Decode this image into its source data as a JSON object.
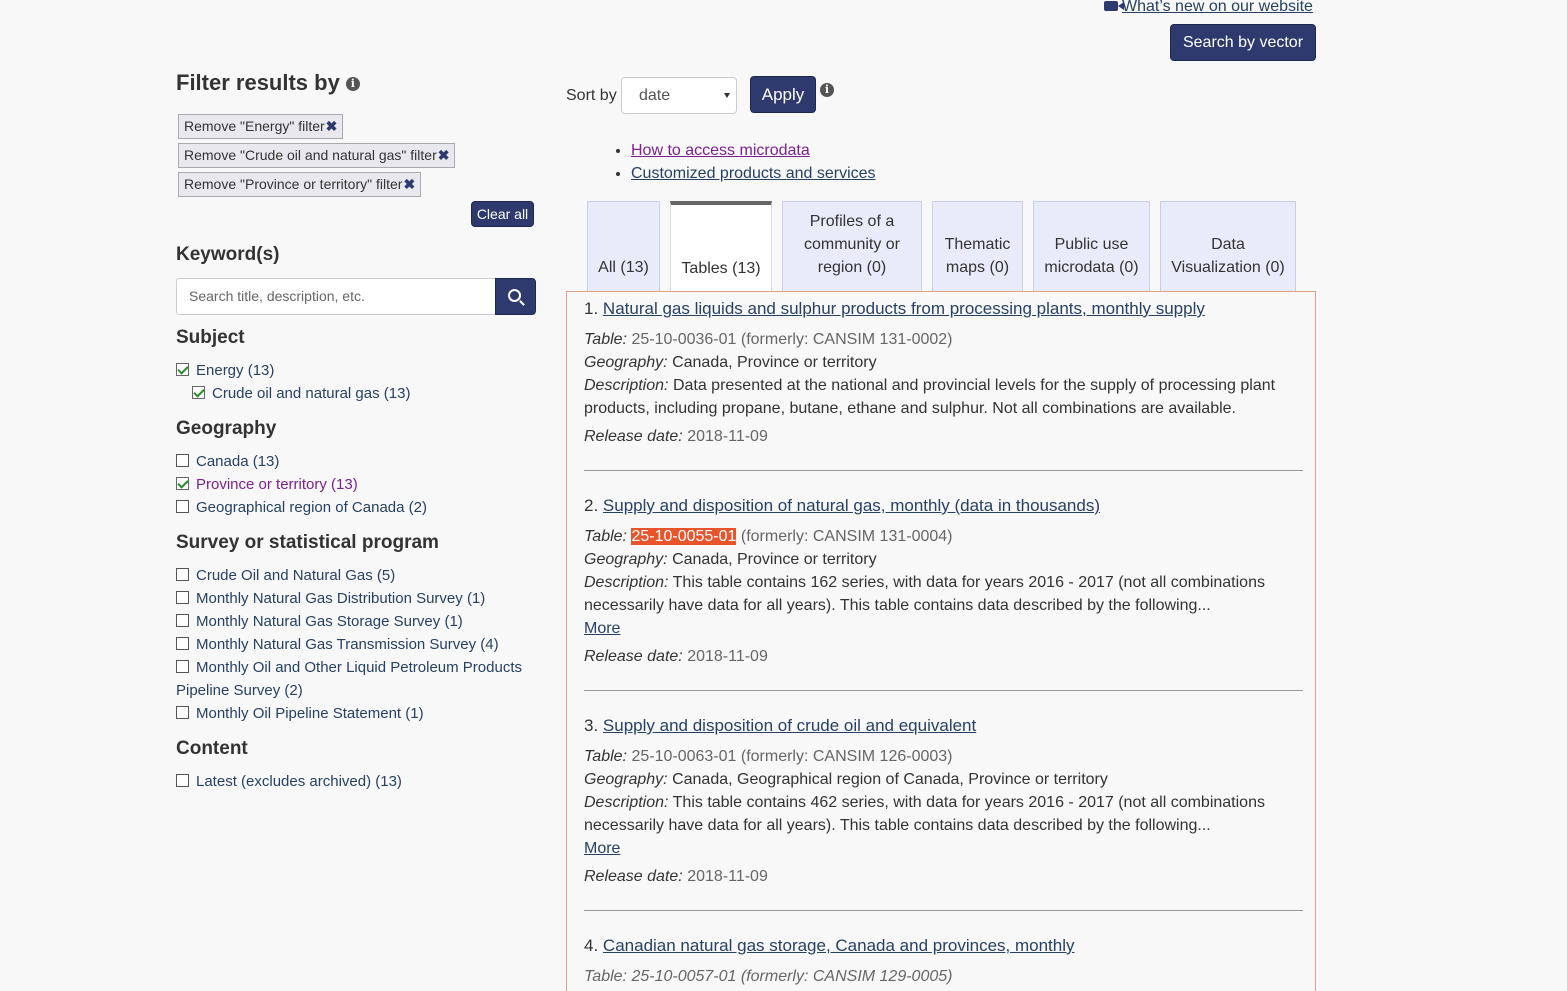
{
  "top": {
    "whats_new": "What’s new on our website",
    "search_by_vector": "Search by vector"
  },
  "filters": {
    "title": "Filter results by",
    "chips": [
      "Remove \"Energy\" filter",
      "Remove \"Crude oil and natural gas\" filter",
      "Remove \"Province or territory\" filter"
    ],
    "chip_close": "✖",
    "clear_all": "Clear all",
    "keyword_heading": "Keyword(s)",
    "search_placeholder": "Search title, description, etc.",
    "subject_heading": "Subject",
    "subject_items": [
      "Energy (13)",
      "Crude oil and natural gas (13)"
    ],
    "geography_heading": "Geography",
    "geography_items": [
      "Canada (13)",
      "Province or territory (13)",
      "Geographical region of Canada (2)"
    ],
    "survey_heading": "Survey or statistical program",
    "survey_items": [
      "Crude Oil and Natural Gas (5)",
      "Monthly Natural Gas Distribution Survey (1)",
      "Monthly Natural Gas Storage Survey (1)",
      "Monthly Natural Gas Transmission Survey (4)",
      "Monthly Oil and Other Liquid Petroleum Products",
      "Pipeline Survey (2)",
      "Monthly Oil Pipeline Statement (1)"
    ],
    "content_heading": "Content",
    "content_items": [
      "Latest (excludes archived) (13)"
    ]
  },
  "sort": {
    "label": "Sort by",
    "value": "date",
    "apply": "Apply"
  },
  "links": [
    "How to access microdata",
    "Customized products and services"
  ],
  "tabs": [
    {
      "line1": "",
      "line2": "All (13)"
    },
    {
      "line1": "",
      "line2": "Tables (13)"
    },
    {
      "line1": "Profiles of a",
      "line2": "community or",
      "line3": "region (0)"
    },
    {
      "line1": "Thematic",
      "line2": "maps (0)"
    },
    {
      "line1": "Public use",
      "line2": "microdata (0)"
    },
    {
      "line1": "Data",
      "line2": "Visualization (0)"
    }
  ],
  "labels": {
    "table": "Table:",
    "geography": "Geography:",
    "description": "Description:",
    "release": "Release date:",
    "more": "More"
  },
  "results": [
    {
      "num": "1.",
      "title": "Natural gas liquids and sulphur products from processing plants, monthly supply",
      "table_id": "25-10-0036-01",
      "formerly": "(formerly: CANSIM 131-0002)",
      "geography": "Canada, Province or territory",
      "desc1": "Data presented at the national and provincial levels for the supply of processing plant",
      "desc2": "products, including propane, butane, ethane and sulphur. Not all combinations are available.",
      "release": "2018-11-09"
    },
    {
      "num": "2.",
      "title": "Supply and disposition of natural gas, monthly (data in thousands)",
      "table_id": "25-10-0055-01",
      "formerly": "(formerly: CANSIM 131-0004)",
      "geography": "Canada, Province or territory",
      "desc1": "This table contains 162 series, with data for years 2016 - 2017 (not all combinations",
      "desc2": "necessarily have data for all years). This table contains data described by the following...",
      "release": "2018-11-09"
    },
    {
      "num": "3.",
      "title": "Supply and disposition of crude oil and equivalent",
      "table_id": "25-10-0063-01",
      "formerly": "(formerly: CANSIM 126-0003)",
      "geography": "Canada, Geographical region of Canada, Province or territory",
      "desc1": "This table contains 462 series, with data for years 2016 - 2017 (not all combinations",
      "desc2": "necessarily have data for all years). This table contains data described by the following...",
      "release": "2018-11-09"
    },
    {
      "num": "4.",
      "title": "Canadian natural gas storage, Canada and provinces, monthly",
      "table_partial": "Table: 25-10-0057-01 (formerly: CANSIM 129-0005)"
    }
  ],
  "colors": {
    "navy": "#2e3a6e",
    "link": "#284162",
    "visited": "#7b2291",
    "highlight": "#e8552c",
    "panel_border": "#e3a08a"
  }
}
